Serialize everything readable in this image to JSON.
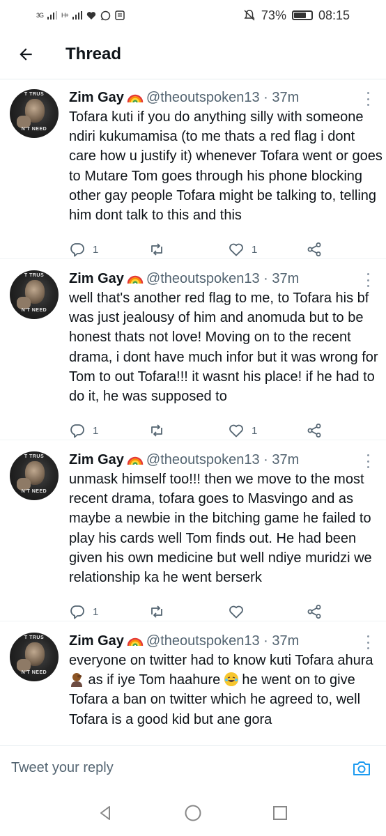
{
  "status_bar": {
    "signal_left": "3G",
    "signal_right": "H+",
    "battery_percent": "73%",
    "battery_level": 0.73,
    "time": "08:15",
    "icons": [
      "heart-icon",
      "whatsapp-icon",
      "message-icon",
      "mute-icon"
    ]
  },
  "header": {
    "title": "Thread",
    "back_icon": "arrow-left-icon"
  },
  "tweets": [
    {
      "name": "Zim Gay",
      "handle": "@theoutspoken13 · 37m",
      "avatar_top_text": "T TRUS",
      "avatar_bottom_text": "N'T NEED",
      "text": "Tofara kuti if you do anything silly with someone ndiri kukumamisa (to me thats a red flag i dont care how u justify it) whenever Tofara went or goes to Mutare Tom goes through his phone blocking other gay people Tofara might be talking to, telling him dont talk to this and this",
      "reply_count": "1",
      "retweet_count": "",
      "like_count": "1"
    },
    {
      "name": "Zim Gay",
      "handle": "@theoutspoken13 · 37m",
      "avatar_top_text": "T TRUS",
      "avatar_bottom_text": "N'T NEED",
      "text": "well that's another red flag to me, to Tofara his bf was just jealousy of him and anomuda but to be honest thats not love! Moving on to the recent drama, i dont have much infor but it was wrong for Tom to out Tofara!!! it wasnt his place! if he had to do it, he was supposed to",
      "reply_count": "1",
      "retweet_count": "",
      "like_count": "1"
    },
    {
      "name": "Zim Gay",
      "handle": "@theoutspoken13 · 37m",
      "avatar_top_text": "T TRUS",
      "avatar_bottom_text": "N'T NEED",
      "text": "unmask himself too!!! then we move to the most recent drama, tofara goes to Masvingo and as maybe a newbie in the bitching game he failed to play his cards well Tom finds out. He had been given his own medicine but well ndiye muridzi we relationship ka he went berserk",
      "reply_count": "1",
      "retweet_count": "",
      "like_count": ""
    },
    {
      "name": "Zim Gay",
      "handle": "@theoutspoken13 · 37m",
      "avatar_top_text": "T TRUS",
      "avatar_bottom_text": "N'T NEED",
      "text_part1": "everyone on twitter had to know kuti Tofara ahura",
      "text_part2": " as if iye Tom haahure ",
      "text_part3": " he went on to give Tofara a ban on twitter which he agreed to, well Tofara is a good kid but ane gora"
    }
  ],
  "reply_bar": {
    "placeholder": "Tweet your reply",
    "camera_icon": "camera-icon"
  },
  "nav": {
    "back_icon": "triangle-back-icon",
    "home_icon": "circle-home-icon",
    "recents_icon": "square-recents-icon"
  },
  "colors": {
    "text_primary": "#0f1419",
    "text_secondary": "#536471",
    "accent": "#1d9bf0"
  }
}
